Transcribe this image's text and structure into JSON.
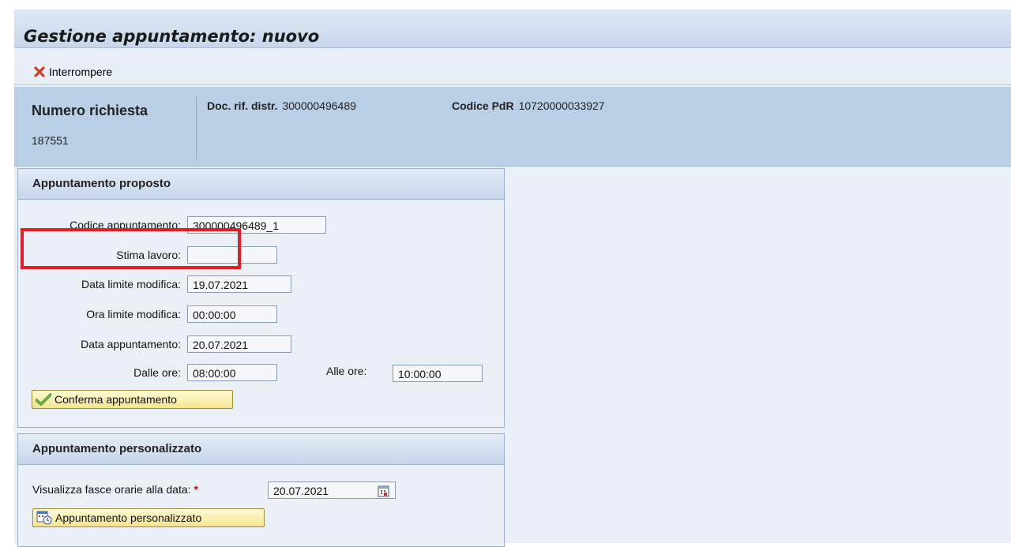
{
  "window": {
    "title": "Gestione appuntamento: nuovo"
  },
  "toolbar": {
    "cancel_label": "Interrompere",
    "cancel_icon": "close-icon"
  },
  "header": {
    "request_label": "Numero richiesta",
    "request_value": "187551",
    "doc_label": "Doc. rif. distr.",
    "doc_value": "300000496489",
    "pdr_label": "Codice PdR",
    "pdr_value": "10720000033927"
  },
  "proposed": {
    "title": "Appuntamento proposto",
    "code_label": "Codice appuntamento:",
    "code_value": "300000496489_1",
    "estimate_label": "Stima lavoro:",
    "estimate_value": "",
    "limit_date_label": "Data limite modifica:",
    "limit_date_value": "19.07.2021",
    "limit_time_label": "Ora limite modifica:",
    "limit_time_value": "00:00:00",
    "date_label": "Data appuntamento:",
    "date_value": "20.07.2021",
    "from_label": "Dalle ore:",
    "from_value": "08:00:00",
    "to_label": "Alle ore:",
    "to_value": "10:00:00",
    "confirm_label": "Conferma appuntamento",
    "confirm_icon": "checkmark-icon"
  },
  "custom": {
    "title": "Appuntamento personalizzato",
    "date_label": "Visualizza fasce orarie alla data:",
    "date_value": "20.07.2021",
    "button_label": "Appuntamento personalizzato",
    "button_icon": "calendar-clock-icon"
  },
  "colors": {
    "highlight": "#e41e25",
    "header_bg": "#b9cfe6",
    "app_bg": "#ebf0f7",
    "button_bg": "#f4e48f"
  }
}
